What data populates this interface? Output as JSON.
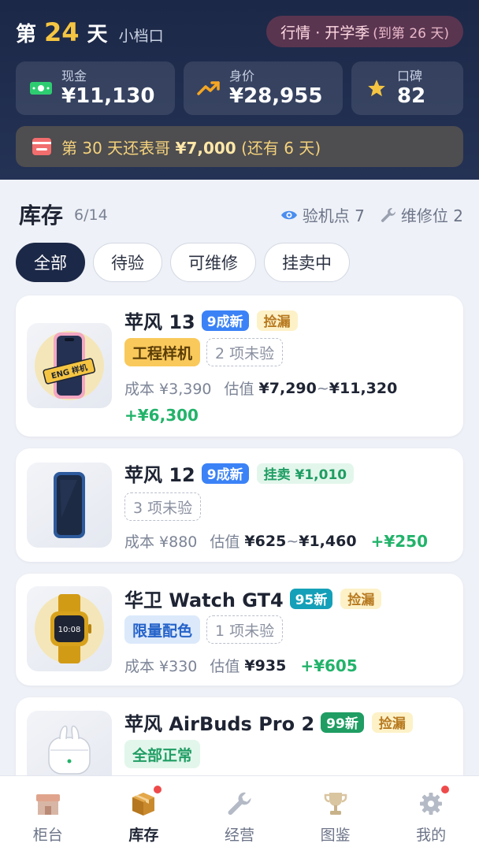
{
  "header": {
    "day_prefix": "第",
    "day_number": "24",
    "day_suffix": "天",
    "stall_name": "小档口",
    "market_main": "行情 · 开学季",
    "market_sub": "(到第 26 天)"
  },
  "stats": {
    "cash": {
      "label": "现金",
      "value": "¥11,130",
      "icon": "cash-icon",
      "color": "#2ecc71"
    },
    "worth": {
      "label": "身价",
      "value": "¥28,955",
      "icon": "trend-up-icon",
      "color": "#f5a623"
    },
    "reputation": {
      "label": "口碑",
      "value": "82",
      "icon": "star-icon",
      "color": "#f5c542"
    }
  },
  "debt": {
    "prefix": "第 30 天还表哥",
    "amount": "¥7,000",
    "suffix": "(还有 6 天)"
  },
  "inventory": {
    "title": "库存",
    "count": "6/14",
    "inspect_points": "验机点 7",
    "repair_slots": "维修位 2",
    "filters": [
      "全部",
      "待验",
      "可维修",
      "挂卖中"
    ],
    "active_filter": "全部"
  },
  "items": [
    {
      "name": "苹风 13",
      "grade": "9成新",
      "grade_color": "#3b82f6",
      "tag": "捡漏",
      "tag_style": "bargain",
      "solid_tag": "工程样机",
      "solid_tag_style": "gold",
      "pending": "2 项未验",
      "cost": "成本 ¥3,390",
      "est_label": "估值",
      "est_low": "¥7,290",
      "est_high": "¥11,320",
      "profit": "+¥6,300",
      "thumb_badge": "ENG 样机"
    },
    {
      "name": "苹风 12",
      "grade": "9成新",
      "grade_color": "#3b82f6",
      "tag": "挂卖 ¥1,010",
      "tag_style": "listed",
      "pending": "3 项未验",
      "cost": "成本 ¥880",
      "est_label": "估值",
      "est_low": "¥625",
      "est_high": "¥1,460",
      "profit": "+¥250"
    },
    {
      "name": "华卫 Watch GT4",
      "grade": "95新",
      "grade_color": "#14a0b8",
      "tag": "捡漏",
      "tag_style": "bargain",
      "solid_tag": "限量配色",
      "solid_tag_style": "blue",
      "pending": "1 项未验",
      "cost": "成本 ¥330",
      "est_label": "估值",
      "est_value": "¥935",
      "profit": "+¥605",
      "thumb_time": "10:08"
    },
    {
      "name": "苹风 AirBuds Pro 2",
      "grade": "99新",
      "grade_color": "#1f9d63",
      "tag": "捡漏",
      "tag_style": "bargain",
      "solid_tag": "全部正常",
      "solid_tag_style": "green"
    }
  ],
  "nav": [
    {
      "label": "柜台",
      "icon": "shop-icon",
      "badge": false
    },
    {
      "label": "库存",
      "icon": "box-icon",
      "badge": true,
      "active": true
    },
    {
      "label": "经营",
      "icon": "wrench-icon",
      "badge": false
    },
    {
      "label": "图鉴",
      "icon": "trophy-icon",
      "badge": false
    },
    {
      "label": "我的",
      "icon": "gear-icon",
      "badge": true
    }
  ]
}
